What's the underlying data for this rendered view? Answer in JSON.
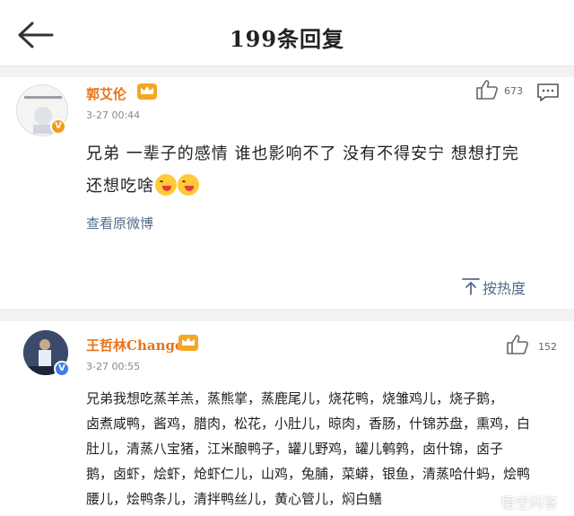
{
  "header": {
    "title": "199条回复",
    "back_icon": "arrow-left-icon"
  },
  "comments": [
    {
      "username": "郭艾伦",
      "time": "3-27 00:44",
      "likes": "673",
      "text_line1": "兄弟 一辈子的感情 谁也影响不了 没有不得安宁 想想打完",
      "text_line2": "还想吃啥",
      "view_original": "查看原微博",
      "sort_label": "按热度",
      "accent": "#e8741a"
    },
    {
      "username": "王哲林Change",
      "time": "3-27 00:55",
      "likes": "152",
      "lines": [
        "兄弟我想吃蒸羊羔，蒸熊掌，蒸鹿尾儿，烧花鸭，烧雏鸡儿，烧子鹅，",
        "卤煮咸鸭，酱鸡，腊肉，松花，小肚儿，晾肉，香肠，什锦苏盘，熏鸡，白",
        "肚儿，清蒸八宝猪，江米酿鸭子，罐儿野鸡，罐儿鹌鹑，卤什锦，卤子",
        "鹅，卤虾，烩虾，炝虾仁儿，山鸡，兔脯，菜蟒，银鱼，清蒸哈什蚂，烩鸭",
        "腰儿，烩鸭条儿，清拌鸭丝儿，黄心管儿，焖白鳝"
      ]
    }
  ],
  "watermark": "悟空问答",
  "colors": {
    "username": "#e8741a",
    "link": "#556b8d",
    "verified": "#f29a1a"
  }
}
